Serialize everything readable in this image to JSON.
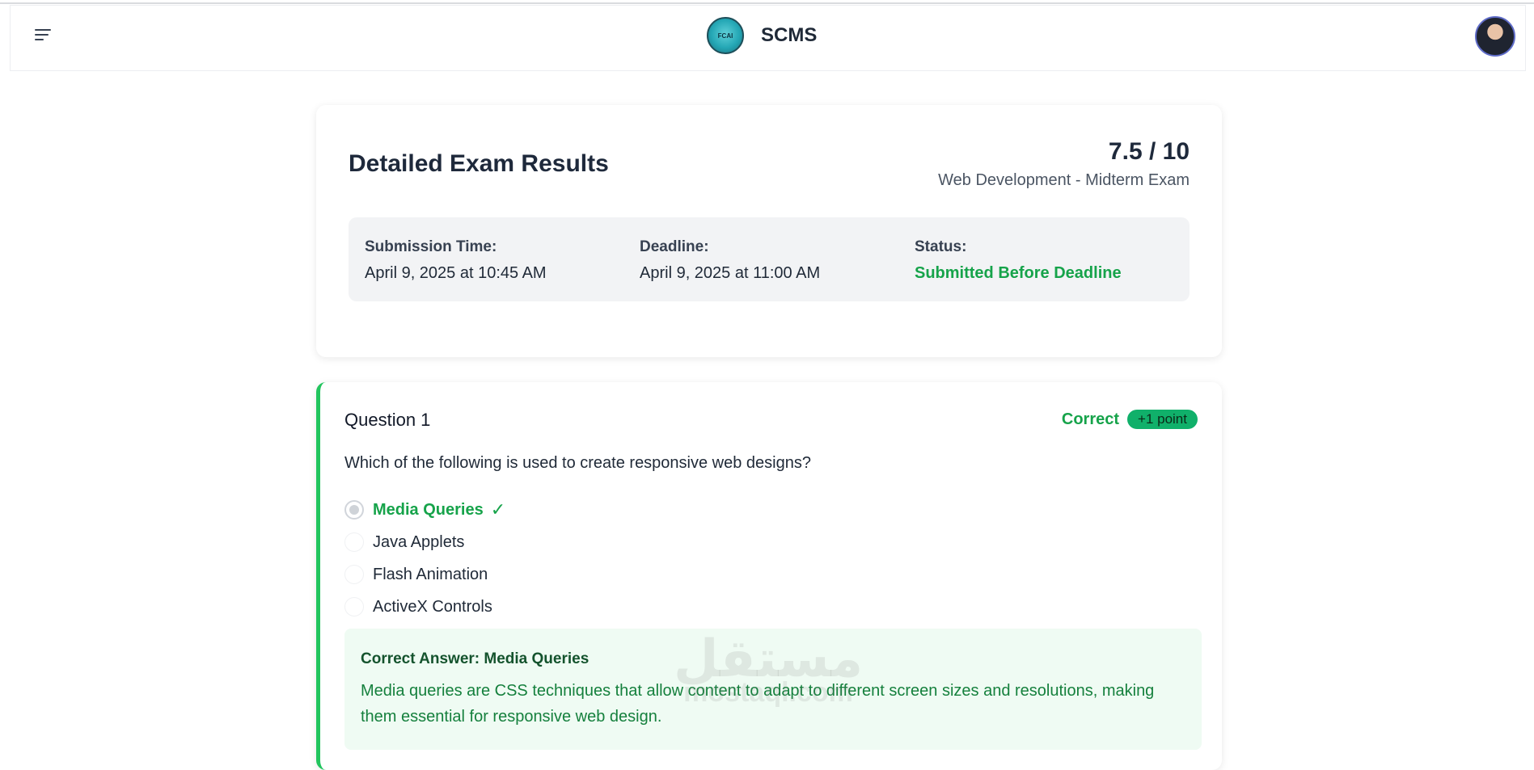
{
  "navbar": {
    "menu_icon": "hamburger-menu-icon",
    "logo_text": "FCAI",
    "app_name": "SCMS",
    "avatar_icon": "user-avatar"
  },
  "summary": {
    "title": "Detailed Exam Results",
    "score": "7.5 / 10",
    "exam_name": "Web Development - Midterm Exam",
    "info": {
      "submission_label": "Submission Time:",
      "submission_value": "April 9, 2025 at 10:45 AM",
      "deadline_label": "Deadline:",
      "deadline_value": "April 9, 2025 at 11:00 AM",
      "status_label": "Status:",
      "status_value": "Submitted Before Deadline"
    }
  },
  "question": {
    "title": "Question 1",
    "result": "Correct",
    "points": "+1 point",
    "text": "Which of the following is used to create responsive web designs?",
    "options": [
      {
        "label": "Media Queries",
        "selected": true,
        "correct": true
      },
      {
        "label": "Java Applets",
        "selected": false,
        "correct": false
      },
      {
        "label": "Flash Animation",
        "selected": false,
        "correct": false
      },
      {
        "label": "ActiveX Controls",
        "selected": false,
        "correct": false
      }
    ],
    "answer_title": "Correct Answer: Media Queries",
    "answer_explanation": "Media queries are CSS techniques that allow content to adapt to different screen sizes and resolutions, making them essential for responsive web design."
  },
  "watermark": {
    "arabic": "مستقل",
    "latin": "mostaql.com"
  },
  "colors": {
    "accent_green": "#16a34a",
    "badge_green": "#10b06a",
    "border_green": "#22c55e"
  }
}
